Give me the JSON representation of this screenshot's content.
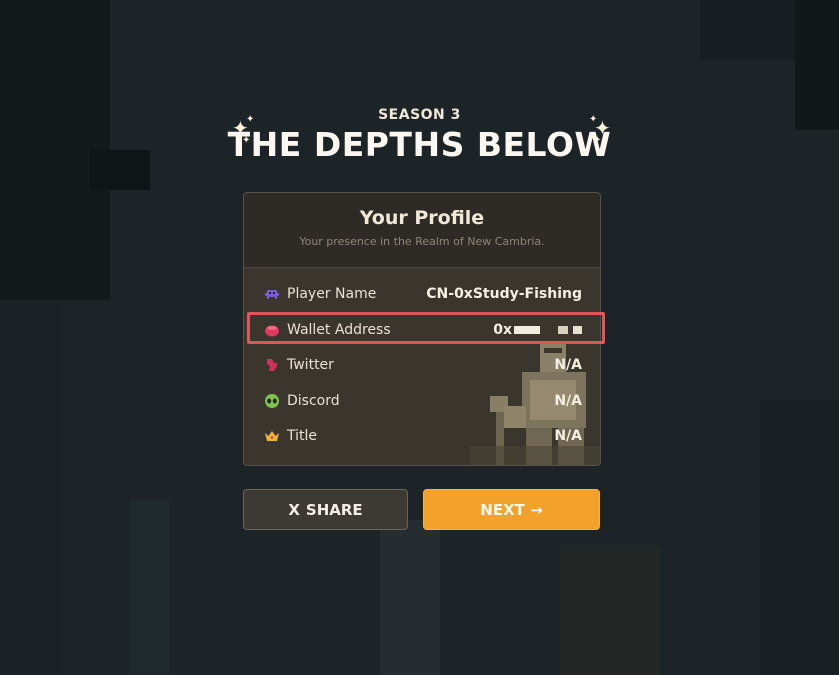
{
  "header": {
    "season": "SEASON 3",
    "title": "THE DEPTHS BELOW"
  },
  "profile": {
    "title": "Your Profile",
    "subtitle": "Your presence in the Realm of New Cambria.",
    "rows": [
      {
        "label": "Player Name",
        "value": "CN-0xStudy-Fishing",
        "icon": "space-invader-icon"
      },
      {
        "label": "Wallet Address",
        "value": "0x",
        "icon": "wallet-icon"
      },
      {
        "label": "Twitter",
        "value": "N/A",
        "icon": "twitter-icon"
      },
      {
        "label": "Discord",
        "value": "N/A",
        "icon": "alien-icon"
      },
      {
        "label": "Title",
        "value": "N/A",
        "icon": "crown-icon"
      }
    ]
  },
  "buttons": {
    "share_icon": "X",
    "share": "SHARE",
    "next": "NEXT →"
  },
  "colors": {
    "accent": "#f2a12a",
    "highlight": "#e0575b"
  }
}
